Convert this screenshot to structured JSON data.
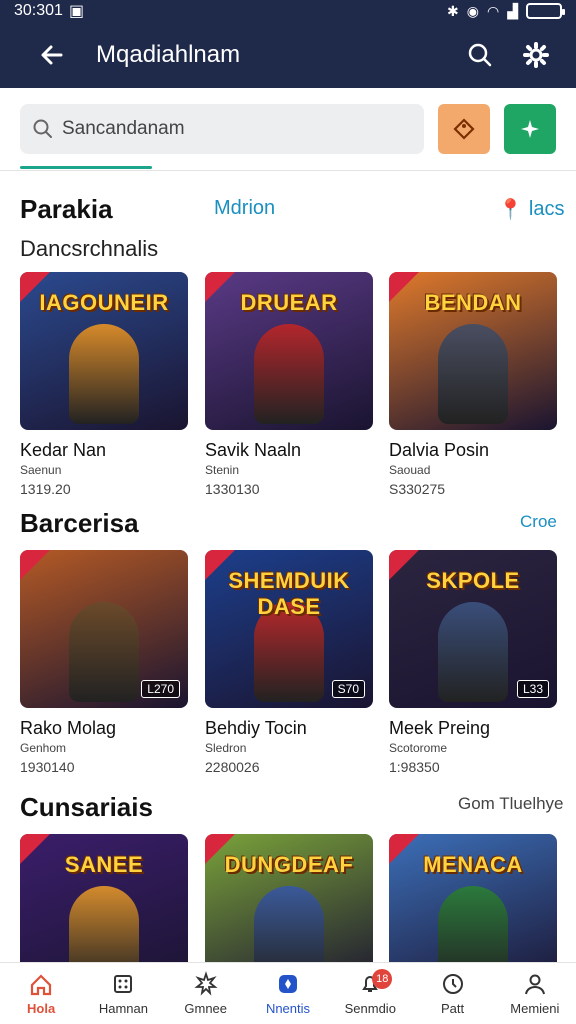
{
  "status": {
    "time": "30:301",
    "battery_icon": "battery-icon"
  },
  "appbar": {
    "title": "Mqadiahlnam"
  },
  "search": {
    "placeholder": "Sancandanam"
  },
  "section1": {
    "title": "Parakia",
    "center_link": "Mdrion",
    "right_link": "lacs",
    "subtitle": "Dancsrchnalis",
    "cards": [
      {
        "art": "IAGOUNEIR",
        "badge": "",
        "name": "Kedar Nan",
        "meta": "Saenun",
        "stat": "1319.20",
        "bg": "#2b4a8f",
        "fig": "#d78a2a"
      },
      {
        "art": "DRUEAR",
        "badge": "",
        "name": "Savik Naaln",
        "meta": "Stenin",
        "stat": "1330130",
        "bg": "#5a3a86",
        "fig": "#b3262c"
      },
      {
        "art": "BENDAN",
        "badge": "",
        "name": "Dalvia Posin",
        "meta": "Saouad",
        "stat": "S330275",
        "bg": "#e07a2b",
        "fig": "#4a4e61"
      }
    ]
  },
  "section2": {
    "title": "Barcerisa",
    "right_link": "Croe",
    "cards": [
      {
        "art": "",
        "badge": "L270",
        "name": "Rako Molag",
        "meta": "Genhom",
        "stat": "1930140",
        "bg": "#b45a25",
        "fig": "#6b4a2a"
      },
      {
        "art": "SHEMDUIK DASE",
        "badge": "S70",
        "name": "Behdiy Tocin",
        "meta": "Sledron",
        "stat": "2280026",
        "bg": "#1d3f8c",
        "fig": "#b8282c"
      },
      {
        "art": "SKPOLE",
        "badge": "L33",
        "name": "Meek Preing",
        "meta": "Scotorome",
        "stat": "1:98350",
        "bg": "#2b2540",
        "fig": "#3a4e7a"
      }
    ]
  },
  "section3": {
    "title": "Cunsariais",
    "right_link": "Gom Tluelhye",
    "cards": [
      {
        "art": "SANEE",
        "badge": "",
        "bg": "#3b1e6b",
        "fig": "#d48b2d"
      },
      {
        "art": "DUNGDEAF",
        "badge": "",
        "bg": "#7aa23a",
        "fig": "#3b5a9a"
      },
      {
        "art": "MENACA",
        "badge": "",
        "bg": "#3c6fb8",
        "fig": "#2b7a3c"
      }
    ]
  },
  "nav": [
    {
      "label": "Hola",
      "icon": "home-icon"
    },
    {
      "label": "Hamnan",
      "icon": "grid-icon"
    },
    {
      "label": "Gmnee",
      "icon": "burst-icon"
    },
    {
      "label": "Nnentis",
      "icon": "compass-icon"
    },
    {
      "label": "Senmdio",
      "icon": "bell-icon",
      "badge": "18"
    },
    {
      "label": "Patt",
      "icon": "clock-icon"
    },
    {
      "label": "Memieni",
      "icon": "profile-icon"
    }
  ]
}
